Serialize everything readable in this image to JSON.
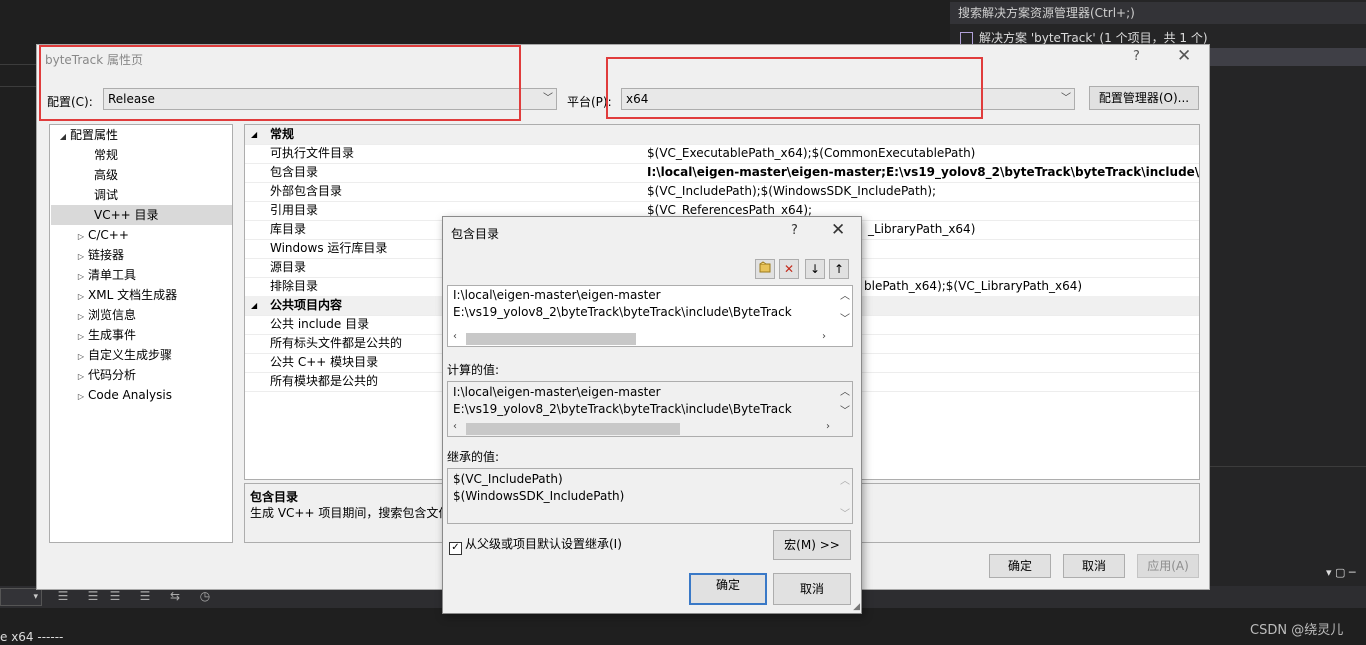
{
  "vs": {
    "solution_search": "搜索解决方案资源管理器(Ctrl+;)",
    "solution_root": "解决方案 'byteTrack' (1 个项目，共 1 个)",
    "output_line": "e x64 ------",
    "watermark": "CSDN @绕灵儿"
  },
  "prop": {
    "title": "byteTrack 属性页",
    "help": "?",
    "close": "✕",
    "config_label": "配置(C):",
    "config_value": "Release",
    "platform_label": "平台(P):",
    "platform_value": "x64",
    "config_manager": "配置管理器(O)...",
    "tree": {
      "root": "配置属性",
      "items": [
        "常规",
        "高级",
        "调试",
        "VC++ 目录",
        "C/C++",
        "链接器",
        "清单工具",
        "XML 文档生成器",
        "浏览信息",
        "生成事件",
        "自定义生成步骤",
        "代码分析",
        "Code Analysis"
      ]
    },
    "grid": {
      "cat_general": "常规",
      "rows": [
        {
          "name": "可执行文件目录",
          "value": "$(VC_ExecutablePath_x64);$(CommonExecutablePath)"
        },
        {
          "name": "包含目录",
          "value": "I:\\local\\eigen-master\\eigen-master;E:\\vs19_yolov8_2\\byteTrack\\byteTrack\\include\\ByteTra"
        },
        {
          "name": "外部包含目录",
          "value": "$(VC_IncludePath);$(WindowsSDK_IncludePath);"
        },
        {
          "name": "引用目录",
          "value": "$(VC_ReferencesPath_x64);"
        },
        {
          "name": "库目录",
          "value": "_LibraryPath_x64)"
        },
        {
          "name": "Windows 运行库目录",
          "value": ""
        },
        {
          "name": "源目录",
          "value": ""
        },
        {
          "name": "排除目录",
          "value": "blePath_x64);$(VC_LibraryPath_x64)"
        }
      ],
      "cat_public": "公共项目内容",
      "public_rows": [
        "公共 include 目录",
        "所有标头文件都是公共的",
        "公共 C++ 模块目录",
        "所有模块都是公共的"
      ]
    },
    "desc_title": "包含目录",
    "desc_text": "生成 VC++ 项目期间，搜索包含文件",
    "ok": "确定",
    "cancel": "取消",
    "apply": "应用(A)"
  },
  "inc": {
    "title": "包含目录",
    "help": "?",
    "close": "✕",
    "lines": [
      "I:\\local\\eigen-master\\eigen-master",
      "E:\\vs19_yolov8_2\\byteTrack\\byteTrack\\include\\ByteTrack"
    ],
    "computed_label": "计算的值:",
    "computed": [
      "I:\\local\\eigen-master\\eigen-master",
      "E:\\vs19_yolov8_2\\byteTrack\\byteTrack\\include\\ByteTrack"
    ],
    "inherited_label": "继承的值:",
    "inherited": [
      "$(VC_IncludePath)",
      "$(WindowsSDK_IncludePath)"
    ],
    "inherit_check": "从父级或项目默认设置继承(I)",
    "macros": "宏(M) >>",
    "ok": "确定",
    "cancel": "取消"
  },
  "colors": {
    "highlight": "#e03c3c",
    "focus": "#3a79c7"
  }
}
